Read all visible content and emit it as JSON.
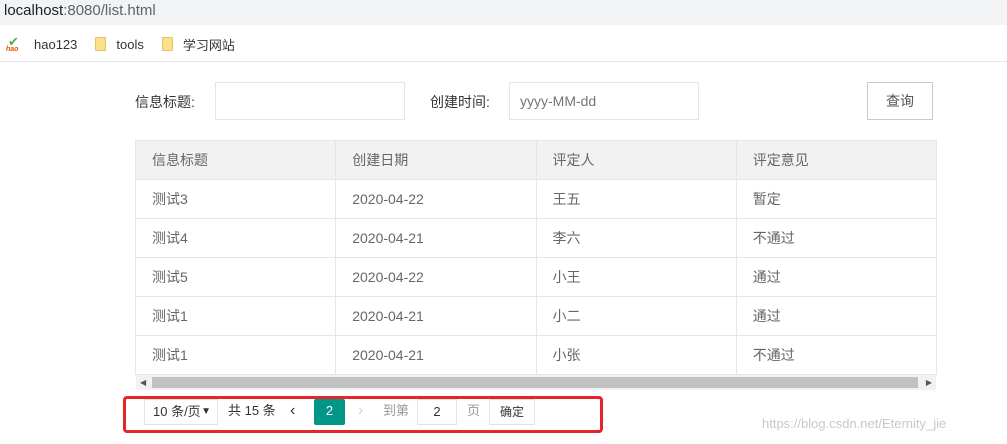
{
  "browser": {
    "url_host": "localhost",
    "url_rest": ":8080/list.html",
    "bookmarks": [
      {
        "label": "hao123",
        "icon": "hao123-icon"
      },
      {
        "label": "tools",
        "icon": "folder-icon"
      },
      {
        "label": "学习网站",
        "icon": "folder-icon"
      }
    ]
  },
  "search": {
    "title_label": "信息标题:",
    "title_value": "",
    "date_label": "创建时间:",
    "date_placeholder": "yyyy-MM-dd",
    "query_button": "查询"
  },
  "table": {
    "headers": [
      "信息标题",
      "创建日期",
      "评定人",
      "评定意见"
    ],
    "rows": [
      [
        "测试3",
        "2020-04-22",
        "王五",
        "暂定"
      ],
      [
        "测试4",
        "2020-04-21",
        "李六",
        "不通过"
      ],
      [
        "测试5",
        "2020-04-22",
        "小王",
        "通过"
      ],
      [
        "测试1",
        "2020-04-21",
        "小二",
        "通过"
      ],
      [
        "测试1",
        "2020-04-21",
        "小张",
        "不通过"
      ]
    ]
  },
  "pagination": {
    "page_size": "10 条/页",
    "total": "共 15 条",
    "current_page": "2",
    "goto_label": "到第",
    "goto_value": "2",
    "page_unit": "页",
    "confirm": "确定"
  },
  "watermark": "https://blog.csdn.net/Eternity_jie",
  "colors": {
    "accent": "#009688",
    "highlight_box": "#e5252a"
  }
}
